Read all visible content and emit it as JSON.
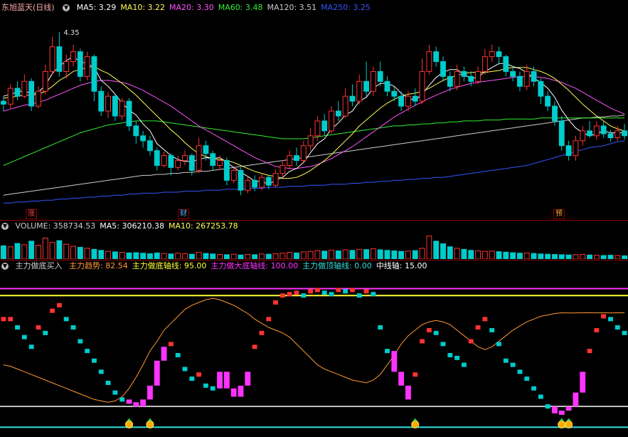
{
  "kline_header": {
    "title": "东旭蓝天(日线)",
    "items": [
      {
        "label": "MA5: 3.29",
        "color": "#ffffff"
      },
      {
        "label": "MA10: 3.22",
        "color": "#ffff55"
      },
      {
        "label": "MA20: 3.30",
        "color": "#ff55ff"
      },
      {
        "label": "MA60: 3.48",
        "color": "#33ee33"
      },
      {
        "label": "MA120: 3.51",
        "color": "#cccccc"
      },
      {
        "label": "MA250: 3.25",
        "color": "#3355ff"
      }
    ],
    "high_label": "4.35"
  },
  "event_tags": [
    {
      "text": "涨",
      "color": "#ff4444"
    },
    {
      "text": "财",
      "color": "#66aaff"
    },
    {
      "text": "预",
      "color": "#ffaa33"
    }
  ],
  "volume_header": {
    "items": [
      {
        "label": "VOLUME: 358734.53",
        "color": "#cccccc"
      },
      {
        "label": "MA5: 306210.38",
        "color": "#ffffff"
      },
      {
        "label": "MA10: 267253.78",
        "color": "#ffff55"
      }
    ]
  },
  "indicator_header": {
    "title": "主力做底买入",
    "items": [
      {
        "label": "主力趋势: 82.54",
        "color": "#ff9933"
      },
      {
        "label": "主力做底轴线: 95.00",
        "color": "#ffff33"
      },
      {
        "label": "主力做大底轴线: 100.00",
        "color": "#ff33ff"
      },
      {
        "label": "主力做顶轴线: 0.00",
        "color": "#33dddd"
      },
      {
        "label": "中线轴: 15.00",
        "color": "#ffffff"
      }
    ]
  },
  "colors": {
    "up": "#ff3333",
    "down": "#00cccc",
    "volume_up": "#ff3333",
    "volume_down": "#00cccc",
    "ma5": "#ffffff",
    "ma10": "#ffff55",
    "ma20": "#ff55ff",
    "ma60": "#33ee33",
    "ma120": "#cccccc",
    "ma250": "#3355ff",
    "trend": "#ff9933",
    "strong": "#ff33ff"
  },
  "kline_data": {
    "ylim": [
      2.5,
      4.5
    ],
    "candles": [
      [
        3.65,
        3.62,
        3.7,
        3.55
      ],
      [
        3.62,
        3.78,
        3.82,
        3.58
      ],
      [
        3.78,
        3.7,
        3.85,
        3.66
      ],
      [
        3.7,
        3.85,
        3.92,
        3.68
      ],
      [
        3.85,
        3.6,
        3.88,
        3.55
      ],
      [
        3.6,
        3.75,
        3.8,
        3.58
      ],
      [
        3.75,
        3.95,
        4.02,
        3.72
      ],
      [
        3.95,
        4.2,
        4.3,
        3.92
      ],
      [
        4.2,
        3.95,
        4.35,
        3.9
      ],
      [
        3.95,
        4.05,
        4.12,
        3.88
      ],
      [
        4.05,
        4.15,
        4.22,
        4.0
      ],
      [
        4.15,
        3.9,
        4.18,
        3.85
      ],
      [
        3.9,
        4.1,
        4.15,
        3.86
      ],
      [
        4.1,
        3.75,
        4.12,
        3.65
      ],
      [
        3.75,
        3.55,
        3.8,
        3.5
      ],
      [
        3.55,
        3.7,
        3.74,
        3.48
      ],
      [
        3.7,
        3.5,
        3.72,
        3.45
      ],
      [
        3.5,
        3.65,
        3.68,
        3.46
      ],
      [
        3.65,
        3.4,
        3.68,
        3.35
      ],
      [
        3.4,
        3.3,
        3.45,
        3.22
      ],
      [
        3.3,
        3.25,
        3.35,
        3.18
      ],
      [
        3.25,
        3.15,
        3.3,
        3.1
      ],
      [
        3.15,
        3.0,
        3.18,
        2.95
      ],
      [
        3.0,
        3.1,
        3.14,
        2.98
      ],
      [
        3.1,
        2.98,
        3.12,
        2.9
      ],
      [
        2.98,
        3.05,
        3.1,
        2.95
      ],
      [
        3.05,
        3.1,
        3.15,
        3.0
      ],
      [
        3.1,
        2.95,
        3.12,
        2.9
      ],
      [
        2.95,
        3.2,
        3.28,
        2.92
      ],
      [
        3.2,
        3.12,
        3.25,
        3.05
      ],
      [
        3.12,
        3.0,
        3.15,
        2.95
      ],
      [
        3.0,
        3.05,
        3.1,
        2.96
      ],
      [
        3.05,
        2.85,
        3.08,
        2.8
      ],
      [
        2.85,
        2.95,
        2.98,
        2.82
      ],
      [
        2.95,
        2.75,
        2.98,
        2.7
      ],
      [
        2.75,
        2.85,
        2.88,
        2.72
      ],
      [
        2.85,
        2.78,
        2.9,
        2.74
      ],
      [
        2.78,
        2.88,
        2.92,
        2.75
      ],
      [
        2.88,
        2.8,
        2.9,
        2.76
      ],
      [
        2.8,
        2.92,
        2.96,
        2.78
      ],
      [
        2.92,
        3.0,
        3.05,
        2.88
      ],
      [
        3.0,
        3.1,
        3.15,
        2.96
      ],
      [
        3.1,
        3.05,
        3.18,
        3.0
      ],
      [
        3.05,
        3.2,
        3.25,
        3.02
      ],
      [
        3.2,
        3.3,
        3.38,
        3.15
      ],
      [
        3.3,
        3.45,
        3.5,
        3.25
      ],
      [
        3.45,
        3.35,
        3.52,
        3.3
      ],
      [
        3.35,
        3.55,
        3.6,
        3.32
      ],
      [
        3.55,
        3.5,
        3.65,
        3.45
      ],
      [
        3.5,
        3.7,
        3.78,
        3.48
      ],
      [
        3.7,
        3.65,
        3.82,
        3.6
      ],
      [
        3.65,
        3.85,
        3.92,
        3.62
      ],
      [
        3.85,
        3.75,
        4.05,
        3.7
      ],
      [
        3.75,
        3.95,
        4.0,
        3.7
      ],
      [
        3.95,
        3.85,
        4.05,
        3.8
      ],
      [
        3.85,
        3.75,
        3.9,
        3.7
      ],
      [
        3.75,
        3.7,
        3.8,
        3.65
      ],
      [
        3.7,
        3.6,
        3.75,
        3.55
      ],
      [
        3.6,
        3.7,
        3.75,
        3.55
      ],
      [
        3.7,
        3.65,
        3.78,
        3.6
      ],
      [
        3.65,
        3.95,
        4.08,
        3.62
      ],
      [
        3.95,
        4.15,
        4.22,
        3.92
      ],
      [
        4.15,
        4.05,
        4.2,
        4.0
      ],
      [
        4.05,
        3.9,
        4.1,
        3.85
      ],
      [
        3.9,
        3.8,
        3.95,
        3.75
      ],
      [
        3.8,
        3.95,
        4.02,
        3.76
      ],
      [
        3.95,
        3.9,
        4.0,
        3.85
      ],
      [
        3.9,
        3.85,
        3.95,
        3.8
      ],
      [
        3.85,
        3.95,
        4.0,
        3.82
      ],
      [
        3.95,
        4.1,
        4.18,
        3.92
      ],
      [
        4.1,
        4.15,
        4.22,
        4.05
      ],
      [
        4.15,
        4.1,
        4.2,
        4.02
      ],
      [
        4.1,
        3.95,
        4.12,
        3.9
      ],
      [
        3.95,
        3.9,
        4.0,
        3.85
      ],
      [
        3.9,
        3.8,
        3.95,
        3.75
      ],
      [
        3.8,
        3.95,
        4.02,
        3.76
      ],
      [
        3.95,
        3.85,
        4.0,
        3.8
      ],
      [
        3.85,
        3.7,
        3.88,
        3.62
      ],
      [
        3.7,
        3.6,
        3.75,
        3.55
      ],
      [
        3.6,
        3.45,
        3.65,
        3.4
      ],
      [
        3.45,
        3.2,
        3.5,
        3.15
      ],
      [
        3.2,
        3.1,
        3.25,
        3.05
      ],
      [
        3.1,
        3.25,
        3.3,
        3.05
      ],
      [
        3.25,
        3.35,
        3.4,
        3.2
      ],
      [
        3.35,
        3.3,
        3.45,
        3.28
      ],
      [
        3.3,
        3.4,
        3.45,
        3.26
      ],
      [
        3.4,
        3.32,
        3.45,
        3.28
      ],
      [
        3.32,
        3.28,
        3.36,
        3.24
      ],
      [
        3.28,
        3.35,
        3.4,
        3.25
      ],
      [
        3.35,
        3.3,
        3.42,
        3.26
      ]
    ],
    "ma5": [
      3.7,
      3.72,
      3.74,
      3.76,
      3.72,
      3.74,
      3.81,
      3.93,
      4.0,
      4.06,
      4.1,
      4.05,
      4.03,
      3.99,
      3.86,
      3.8,
      3.72,
      3.63,
      3.56,
      3.51,
      3.42,
      3.35,
      3.22,
      3.16,
      3.1,
      3.06,
      3.04,
      3.04,
      3.06,
      3.08,
      3.07,
      3.08,
      3.03,
      2.98,
      2.93,
      2.89,
      2.84,
      2.84,
      2.81,
      2.85,
      2.88,
      2.94,
      2.97,
      3.03,
      3.13,
      3.22,
      3.27,
      3.37,
      3.43,
      3.51,
      3.55,
      3.65,
      3.69,
      3.78,
      3.83,
      3.83,
      3.8,
      3.73,
      3.68,
      3.66,
      3.72,
      3.81,
      3.89,
      3.94,
      3.97,
      3.97,
      3.92,
      3.88,
      3.89,
      3.95,
      3.99,
      4.03,
      4.03,
      4.0,
      3.98,
      3.94,
      3.88,
      3.84,
      3.78,
      3.69,
      3.56,
      3.46,
      3.38,
      3.33,
      3.3,
      3.32,
      3.35,
      3.33,
      3.33,
      3.33
    ],
    "ma10": [
      3.68,
      3.69,
      3.7,
      3.71,
      3.71,
      3.72,
      3.75,
      3.8,
      3.86,
      3.9,
      3.95,
      3.97,
      3.99,
      4.0,
      3.96,
      3.93,
      3.88,
      3.83,
      3.77,
      3.71,
      3.64,
      3.57,
      3.5,
      3.43,
      3.36,
      3.3,
      3.23,
      3.17,
      3.12,
      3.09,
      3.07,
      3.06,
      3.05,
      3.03,
      3.0,
      2.97,
      2.94,
      2.92,
      2.9,
      2.89,
      2.87,
      2.87,
      2.88,
      2.91,
      2.95,
      3.0,
      3.05,
      3.11,
      3.18,
      3.25,
      3.32,
      3.4,
      3.46,
      3.52,
      3.58,
      3.63,
      3.67,
      3.7,
      3.72,
      3.73,
      3.75,
      3.78,
      3.82,
      3.86,
      3.89,
      3.91,
      3.93,
      3.94,
      3.94,
      3.94,
      3.95,
      3.96,
      3.98,
      3.99,
      3.99,
      3.99,
      3.97,
      3.95,
      3.92,
      3.88,
      3.82,
      3.76,
      3.69,
      3.62,
      3.56,
      3.5,
      3.45,
      3.4,
      3.37,
      3.35
    ],
    "ma20": [
      3.55,
      3.57,
      3.59,
      3.61,
      3.62,
      3.64,
      3.66,
      3.69,
      3.72,
      3.75,
      3.78,
      3.81,
      3.83,
      3.85,
      3.86,
      3.86,
      3.85,
      3.84,
      3.82,
      3.79,
      3.76,
      3.72,
      3.68,
      3.64,
      3.6,
      3.55,
      3.5,
      3.45,
      3.4,
      3.36,
      3.32,
      3.28,
      3.24,
      3.2,
      3.16,
      3.12,
      3.08,
      3.05,
      3.02,
      2.99,
      2.98,
      2.97,
      2.97,
      2.98,
      2.99,
      3.01,
      3.04,
      3.07,
      3.11,
      3.15,
      3.19,
      3.24,
      3.29,
      3.34,
      3.39,
      3.44,
      3.49,
      3.53,
      3.57,
      3.61,
      3.64,
      3.68,
      3.71,
      3.74,
      3.77,
      3.79,
      3.81,
      3.83,
      3.84,
      3.85,
      3.86,
      3.87,
      3.88,
      3.89,
      3.9,
      3.9,
      3.9,
      3.89,
      3.88,
      3.86,
      3.84,
      3.81,
      3.78,
      3.74,
      3.7,
      3.66,
      3.62,
      3.58,
      3.55,
      3.52
    ],
    "ma60": [
      3.0,
      3.03,
      3.06,
      3.09,
      3.12,
      3.15,
      3.18,
      3.21,
      3.24,
      3.27,
      3.3,
      3.33,
      3.35,
      3.37,
      3.39,
      3.41,
      3.42,
      3.43,
      3.44,
      3.45,
      3.45,
      3.45,
      3.45,
      3.44,
      3.43,
      3.42,
      3.41,
      3.4,
      3.39,
      3.38,
      3.37,
      3.36,
      3.35,
      3.34,
      3.33,
      3.32,
      3.31,
      3.3,
      3.29,
      3.28,
      3.27,
      3.27,
      3.27,
      3.27,
      3.28,
      3.29,
      3.3,
      3.31,
      3.32,
      3.33,
      3.34,
      3.35,
      3.36,
      3.37,
      3.38,
      3.39,
      3.4,
      3.4,
      3.41,
      3.41,
      3.42,
      3.42,
      3.43,
      3.43,
      3.44,
      3.44,
      3.45,
      3.45,
      3.45,
      3.46,
      3.46,
      3.46,
      3.47,
      3.47,
      3.47,
      3.47,
      3.47,
      3.48,
      3.48,
      3.48,
      3.48,
      3.48,
      3.48,
      3.48,
      3.48,
      3.48,
      3.48,
      3.48,
      3.48,
      3.48
    ],
    "ma120": [
      2.7,
      2.71,
      2.72,
      2.73,
      2.74,
      2.75,
      2.76,
      2.77,
      2.78,
      2.79,
      2.8,
      2.81,
      2.82,
      2.83,
      2.84,
      2.85,
      2.86,
      2.87,
      2.88,
      2.89,
      2.9,
      2.9,
      2.91,
      2.91,
      2.92,
      2.92,
      2.93,
      2.93,
      2.94,
      2.94,
      2.95,
      2.96,
      2.97,
      2.98,
      2.99,
      3.0,
      3.01,
      3.02,
      3.03,
      3.04,
      3.05,
      3.06,
      3.07,
      3.08,
      3.09,
      3.1,
      3.11,
      3.12,
      3.13,
      3.14,
      3.15,
      3.16,
      3.17,
      3.18,
      3.19,
      3.2,
      3.21,
      3.22,
      3.23,
      3.24,
      3.25,
      3.26,
      3.27,
      3.28,
      3.29,
      3.3,
      3.31,
      3.32,
      3.33,
      3.34,
      3.35,
      3.36,
      3.37,
      3.38,
      3.39,
      3.4,
      3.41,
      3.42,
      3.43,
      3.44,
      3.45,
      3.46,
      3.47,
      3.48,
      3.48,
      3.49,
      3.49,
      3.5,
      3.5,
      3.51
    ],
    "ma250": [
      2.62,
      2.62,
      2.63,
      2.63,
      2.64,
      2.64,
      2.65,
      2.65,
      2.66,
      2.66,
      2.67,
      2.67,
      2.68,
      2.68,
      2.69,
      2.69,
      2.7,
      2.7,
      2.71,
      2.71,
      2.72,
      2.72,
      2.72,
      2.73,
      2.73,
      2.73,
      2.74,
      2.74,
      2.74,
      2.75,
      2.75,
      2.75,
      2.76,
      2.76,
      2.76,
      2.77,
      2.77,
      2.77,
      2.78,
      2.78,
      2.78,
      2.79,
      2.79,
      2.79,
      2.8,
      2.8,
      2.8,
      2.81,
      2.81,
      2.81,
      2.82,
      2.82,
      2.83,
      2.83,
      2.84,
      2.84,
      2.85,
      2.85,
      2.86,
      2.86,
      2.87,
      2.87,
      2.88,
      2.88,
      2.89,
      2.9,
      2.91,
      2.92,
      2.93,
      2.94,
      2.95,
      2.96,
      2.97,
      2.98,
      2.99,
      3.0,
      3.02,
      3.04,
      3.06,
      3.08,
      3.1,
      3.12,
      3.14,
      3.16,
      3.18,
      3.19,
      3.2,
      3.22,
      3.24,
      3.25
    ]
  },
  "volume_data": {
    "ylim": [
      0,
      1000000
    ],
    "values": [
      520000,
      480000,
      610000,
      560000,
      700000,
      540000,
      820000,
      650000,
      720000,
      580000,
      500000,
      460000,
      420000,
      380000,
      340000,
      300000,
      280000,
      260000,
      240000,
      250000,
      230000,
      210000,
      240000,
      220000,
      200000,
      230000,
      210000,
      190000,
      260000,
      220000,
      200000,
      180000,
      170000,
      190000,
      160000,
      180000,
      170000,
      200000,
      190000,
      210000,
      230000,
      260000,
      240000,
      280000,
      300000,
      330000,
      310000,
      350000,
      320000,
      360000,
      340000,
      380000,
      370000,
      400000,
      360000,
      340000,
      320000,
      300000,
      310000,
      330000,
      420000,
      900000,
      700000,
      600000,
      480000,
      420000,
      380000,
      340000,
      320000,
      300000,
      310000,
      290000,
      270000,
      250000,
      230000,
      240000,
      220000,
      200000,
      190000,
      180000,
      170000,
      160000,
      170000,
      180000,
      160000,
      150000,
      140000,
      150000,
      140000,
      130000
    ]
  },
  "indicator_data": {
    "ylim": [
      -5,
      110
    ],
    "values": [
      78,
      78,
      72,
      65,
      58,
      72,
      68,
      84,
      88,
      78,
      72,
      62,
      55,
      48,
      40,
      32,
      25,
      20,
      18,
      15,
      20,
      30,
      48,
      58,
      60,
      52,
      42,
      35,
      38,
      30,
      28,
      40,
      28,
      22,
      30,
      40,
      58,
      68,
      78,
      90,
      95,
      96,
      97,
      95,
      98,
      99,
      97,
      96,
      99,
      98,
      99,
      95,
      98,
      96,
      72,
      55,
      40,
      30,
      20,
      38,
      62,
      70,
      68,
      60,
      52,
      50,
      45,
      62,
      72,
      78,
      70,
      60,
      48,
      45,
      40,
      35,
      28,
      22,
      15,
      10,
      12,
      15,
      25,
      40,
      55,
      70,
      80,
      78,
      72,
      68
    ],
    "trend": [
      45,
      44,
      42,
      40,
      38,
      36,
      34,
      32,
      30,
      28,
      26,
      24,
      22,
      20,
      19,
      18,
      19,
      22,
      28,
      36,
      45,
      55,
      62,
      70,
      75,
      80,
      85,
      88,
      90,
      92,
      93,
      92,
      90,
      88,
      85,
      82,
      78,
      75,
      72,
      70,
      68,
      65,
      60,
      55,
      50,
      45,
      42,
      40,
      38,
      36,
      34,
      33,
      32,
      34,
      38,
      45,
      52,
      60,
      66,
      70,
      74,
      76,
      77,
      76,
      74,
      70,
      66,
      62,
      58,
      56,
      58,
      62,
      66,
      70,
      73,
      76,
      78,
      80,
      81,
      82,
      82.54,
      82.4,
      82.5,
      82.54,
      82.6,
      82.5,
      82.54,
      82.5,
      82.54,
      82.54
    ],
    "strong_flags": [
      0,
      0,
      0,
      0,
      0,
      0,
      0,
      0,
      0,
      0,
      0,
      0,
      0,
      0,
      0,
      0,
      0,
      0,
      1,
      1,
      1,
      1,
      1,
      1,
      0,
      0,
      0,
      0,
      0,
      0,
      0,
      1,
      1,
      1,
      1,
      1,
      0,
      0,
      0,
      0,
      0,
      0,
      0,
      0,
      0,
      0,
      0,
      0,
      0,
      0,
      0,
      0,
      0,
      0,
      0,
      0,
      1,
      1,
      1,
      0,
      0,
      0,
      0,
      0,
      0,
      0,
      0,
      0,
      0,
      0,
      0,
      0,
      0,
      0,
      0,
      0,
      0,
      0,
      0,
      1,
      1,
      1,
      1,
      1,
      0,
      0,
      0,
      0,
      0,
      0
    ],
    "signals": [
      18,
      21,
      59,
      80,
      81
    ]
  }
}
